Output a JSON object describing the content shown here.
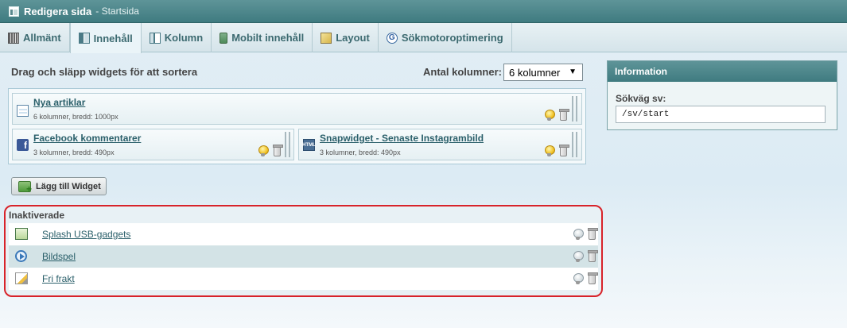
{
  "window": {
    "title": "Redigera sida",
    "subtitle": "- Startsida"
  },
  "tabs": [
    {
      "label": "Allmänt",
      "icon": "overview-icon",
      "active": false
    },
    {
      "label": "Innehåll",
      "icon": "content-icon",
      "active": true
    },
    {
      "label": "Kolumn",
      "icon": "column-icon",
      "active": false
    },
    {
      "label": "Mobilt innehåll",
      "icon": "mobile-icon",
      "active": false
    },
    {
      "label": "Layout",
      "icon": "layout-icon",
      "active": false
    },
    {
      "label": "Sökmotoroptimering",
      "icon": "seo-icon",
      "active": false
    }
  ],
  "main": {
    "drag_hint": "Drag och släpp widgets för att sortera",
    "columns_label": "Antal kolumner:",
    "columns_value": "6 kolumner",
    "widgets": [
      {
        "title": "Nya artiklar",
        "meta": "6 kolumner, bredd: 1000px",
        "icon": "article-icon"
      },
      {
        "title": "Facebook kommentarer",
        "meta": "3 kolumner, bredd: 490px",
        "icon": "facebook-icon"
      },
      {
        "title": "Snapwidget - Senaste Instagrambild",
        "meta": "3 kolumner, bredd: 490px",
        "icon": "html-icon"
      }
    ],
    "add_widget_label": "Lägg till Widget"
  },
  "inactive": {
    "title": "Inaktiverade",
    "items": [
      {
        "label": "Splash USB-gadgets",
        "icon": "splash-icon"
      },
      {
        "label": "Bildspel",
        "icon": "slideshow-icon"
      },
      {
        "label": "Fri frakt",
        "icon": "edit-icon"
      }
    ]
  },
  "info": {
    "title": "Information",
    "path_label": "Sökväg sv:",
    "path_value": "/sv/start"
  },
  "colors": {
    "header": "#4a8488",
    "accent_border": "#d8232a",
    "link": "#2a5f6a"
  }
}
